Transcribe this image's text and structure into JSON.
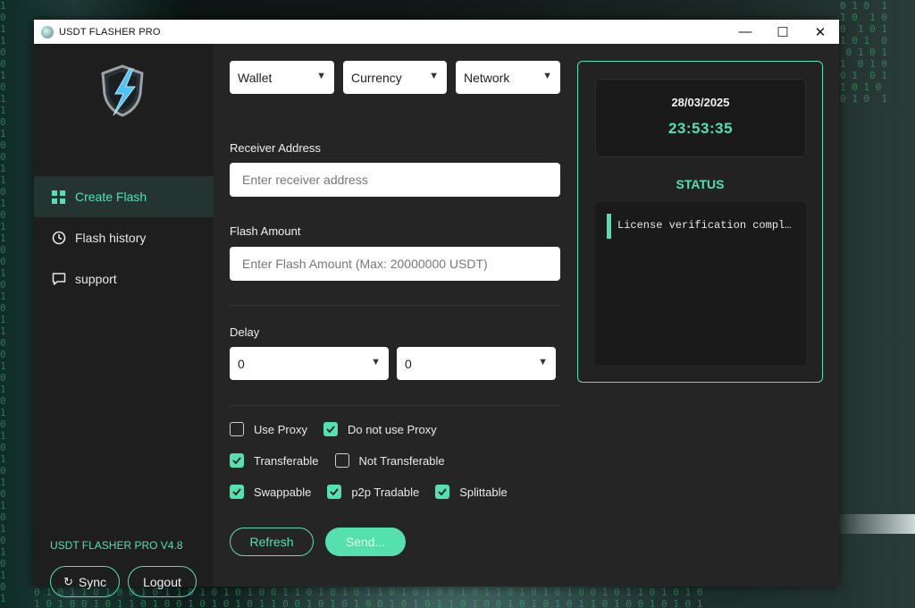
{
  "window": {
    "title": "USDT FLASHER PRO",
    "controls": {
      "minimize": "—",
      "maximize": "☐",
      "close": "✕"
    }
  },
  "sidebar": {
    "items": [
      {
        "label": "Create Flash",
        "icon": "grid-icon",
        "active": true
      },
      {
        "label": "Flash history",
        "icon": "clock-icon",
        "active": false
      },
      {
        "label": "support",
        "icon": "chat-icon",
        "active": false
      }
    ],
    "version": "USDT FLASHER PRO V4.8",
    "sync_label": "Sync",
    "sync_icon": "↻",
    "logout_label": "Logout"
  },
  "form": {
    "wallet_select": "Wallet",
    "currency_select": "Currency",
    "network_select": "Network",
    "receiver_label": "Receiver Address",
    "receiver_placeholder": "Enter receiver address",
    "amount_label": "Flash Amount",
    "amount_placeholder": "Enter Flash Amount (Max: 20000000 USDT)",
    "delay_label": "Delay",
    "delay_1": "0",
    "delay_2": "0",
    "options": {
      "use_proxy": {
        "label": "Use Proxy",
        "checked": false
      },
      "no_proxy": {
        "label": "Do not use Proxy",
        "checked": true
      },
      "transferable": {
        "label": "Transferable",
        "checked": true
      },
      "not_transferable": {
        "label": "Not Transferable",
        "checked": false
      },
      "swappable": {
        "label": "Swappable",
        "checked": true
      },
      "p2p": {
        "label": "p2p Tradable",
        "checked": true
      },
      "splittable": {
        "label": "Splittable",
        "checked": true
      }
    },
    "refresh_label": "Refresh",
    "send_label": "Send..."
  },
  "status": {
    "date": "28/03/2025",
    "time": "23:53:35",
    "title": "STATUS",
    "log": [
      "License verification completed"
    ]
  },
  "colors": {
    "accent": "#55e0b0",
    "window_bg": "#252525",
    "sidebar_bg": "#1e1e1e"
  }
}
